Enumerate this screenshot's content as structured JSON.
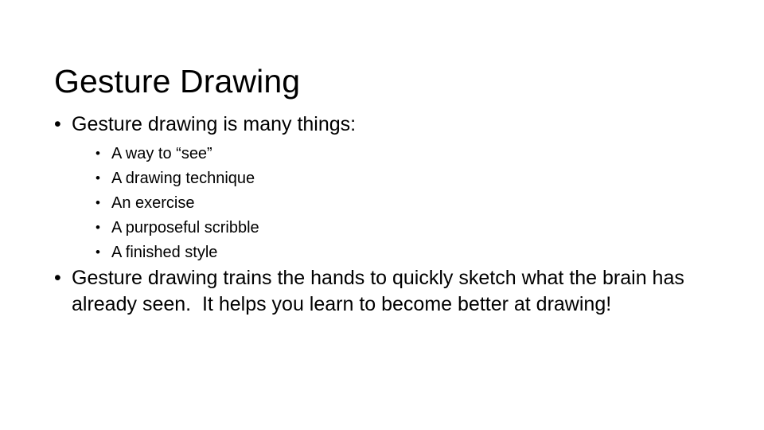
{
  "slide": {
    "title": "Gesture Drawing",
    "bullet_glyph": "•",
    "blocks": [
      {
        "text": "Gesture drawing is many things:",
        "subitems": [
          "A way to “see”",
          "A drawing technique",
          "An exercise",
          "A purposeful scribble",
          "A finished style"
        ]
      },
      {
        "text": "Gesture drawing trains the hands to quickly sketch what the brain has already seen.  It helps you learn to become better at drawing!",
        "subitems": []
      }
    ],
    "colors": {
      "background": "#ffffff",
      "text": "#000000"
    }
  }
}
